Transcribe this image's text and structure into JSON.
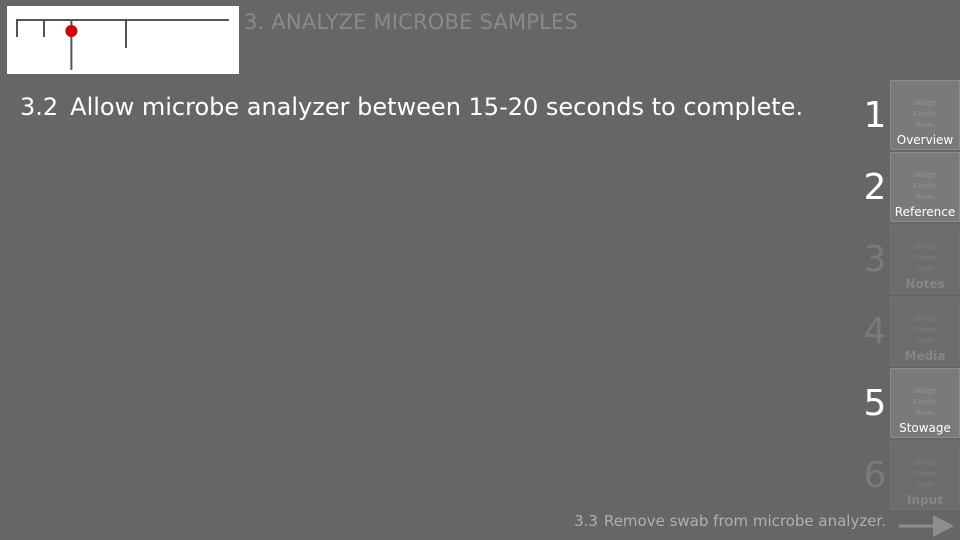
{
  "header": {
    "section_title": "3. ANALYZE MICROBE SAMPLES"
  },
  "progress": {
    "current_position": 0.26
  },
  "step": {
    "number": "3.2",
    "text": "Allow microbe analyzer between 15-20 seconds to complete."
  },
  "side_panel": {
    "thumbnail_placeholder": [
      "Image",
      "Comin",
      "Soon"
    ],
    "items": [
      {
        "number": "1",
        "label": "Overview",
        "enabled": true
      },
      {
        "number": "2",
        "label": "Reference",
        "enabled": true
      },
      {
        "number": "3",
        "label": "Notes",
        "enabled": false
      },
      {
        "number": "4",
        "label": "Media",
        "enabled": false
      },
      {
        "number": "5",
        "label": "Stowage",
        "enabled": true
      },
      {
        "number": "6",
        "label": "Input",
        "enabled": false
      }
    ]
  },
  "next_step": {
    "number": "3.3",
    "text": "Remove swab from microbe analyzer."
  },
  "colors": {
    "background": "#666666",
    "progress_marker": "#d40000"
  }
}
